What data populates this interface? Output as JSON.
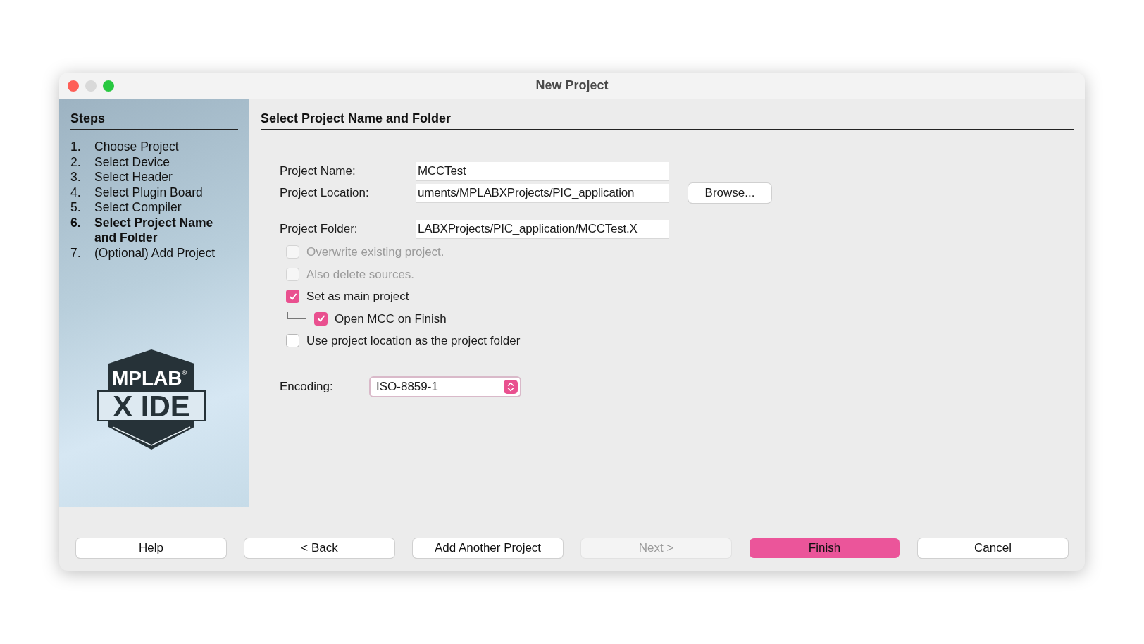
{
  "window": {
    "title": "New Project"
  },
  "sidebar": {
    "title": "Steps",
    "steps": [
      {
        "number": "1.",
        "label": "Choose Project",
        "selected": false
      },
      {
        "number": "2.",
        "label": "Select Device",
        "selected": false
      },
      {
        "number": "3.",
        "label": "Select Header",
        "selected": false
      },
      {
        "number": "4.",
        "label": "Select Plugin Board",
        "selected": false
      },
      {
        "number": "5.",
        "label": "Select Compiler",
        "selected": false
      },
      {
        "number": "6.",
        "label": "Select Project Name and Folder",
        "selected": true
      },
      {
        "number": "7.",
        "label": "(Optional) Add Project",
        "selected": false
      }
    ],
    "logo": {
      "line1": "MPLAB",
      "mark": "®",
      "line2": "X IDE"
    }
  },
  "panel": {
    "title": "Select Project Name and Folder",
    "project_name": {
      "label": "Project Name:",
      "value": "MCCTest"
    },
    "project_location": {
      "label": "Project Location:",
      "value": "uments/MPLABXProjects/PIC_application",
      "button": "Browse..."
    },
    "project_folder": {
      "label": "Project Folder:",
      "value": "LABXProjects/PIC_application/MCCTest.X"
    },
    "options": [
      {
        "label": "Overwrite existing project.",
        "checked": false,
        "disabled": true
      },
      {
        "label": "Also delete sources.",
        "checked": false,
        "disabled": true
      },
      {
        "label": "Set as main project",
        "checked": true,
        "disabled": false,
        "children": [
          {
            "label": "Open MCC on Finish",
            "checked": true,
            "disabled": false
          }
        ]
      },
      {
        "label": "Use project location as the project folder",
        "checked": false,
        "disabled": false
      }
    ],
    "encoding": {
      "label": "Encoding:",
      "value": "ISO-8859-1"
    }
  },
  "buttons": [
    {
      "label": "Help",
      "kind": "default",
      "disabled": false
    },
    {
      "label": "< Back",
      "kind": "default",
      "disabled": false
    },
    {
      "label": "Add Another Project",
      "kind": "default",
      "disabled": false
    },
    {
      "label": "Next >",
      "kind": "default",
      "disabled": true
    },
    {
      "label": "Finish",
      "kind": "primary",
      "disabled": false
    },
    {
      "label": "Cancel",
      "kind": "default",
      "disabled": false
    }
  ]
}
